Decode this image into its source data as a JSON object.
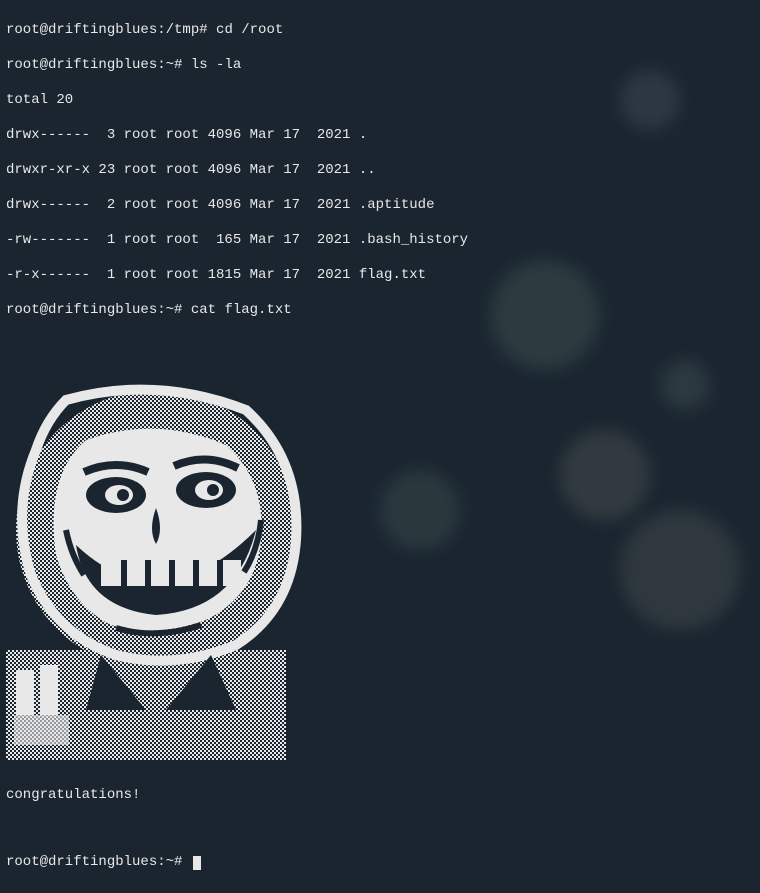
{
  "prompts": {
    "user": "root",
    "host": "driftingblues",
    "prompt_tmp": "root@driftingblues:/tmp# ",
    "prompt_home": "root@driftingblues:~# "
  },
  "commands": {
    "cd": "cd /root",
    "ls": "ls -la",
    "cat": "cat flag.txt"
  },
  "ls_output": {
    "total": "total 20",
    "rows": [
      "drwx------  3 root root 4096 Mar 17  2021 .",
      "drwxr-xr-x 23 root root 4096 Mar 17  2021 ..",
      "drwx------  2 root root 4096 Mar 17  2021 .aptitude",
      "-rw-------  1 root root  165 Mar 17  2021 .bash_history",
      "-r-x------  1 root root 1815 Mar 17  2021 flag.txt"
    ]
  },
  "flag_message": "congratulations!"
}
